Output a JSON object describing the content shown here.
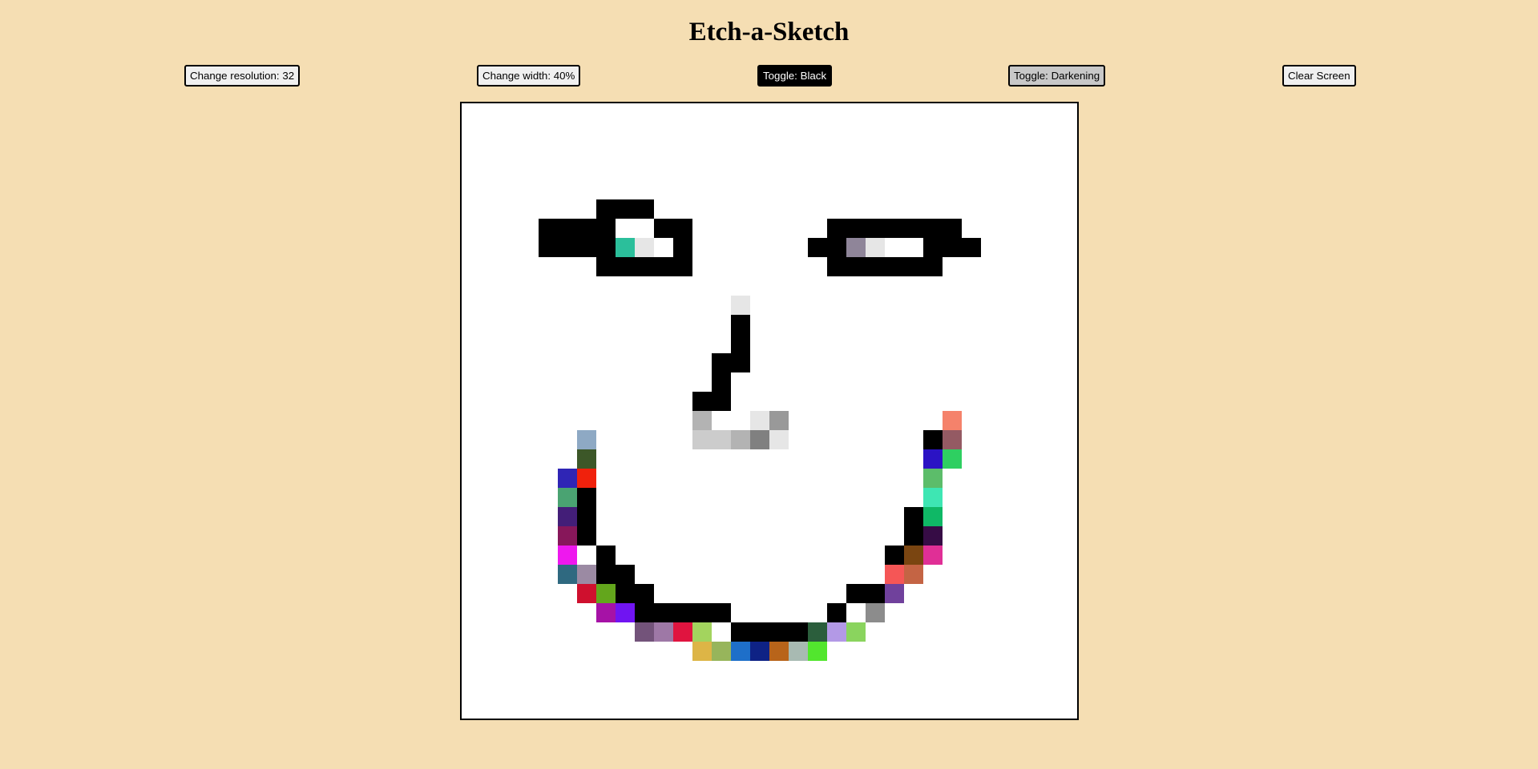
{
  "app": {
    "title": "Etch-a-Sketch"
  },
  "controls": {
    "resolution_label": "Change resolution: 32",
    "width_label": "Change width: 40%",
    "color_toggle_label": "Toggle: Black",
    "mode_toggle_label": "Toggle: Darkening",
    "clear_label": "Clear Screen"
  },
  "grid": {
    "resolution": 32,
    "background": "#ffffff",
    "painted_cells": [
      {
        "r": 5,
        "c": 7,
        "color": "#000000"
      },
      {
        "r": 5,
        "c": 8,
        "color": "#000000"
      },
      {
        "r": 5,
        "c": 9,
        "color": "#000000"
      },
      {
        "r": 6,
        "c": 4,
        "color": "#000000"
      },
      {
        "r": 6,
        "c": 5,
        "color": "#000000"
      },
      {
        "r": 6,
        "c": 6,
        "color": "#000000"
      },
      {
        "r": 6,
        "c": 7,
        "color": "#000000"
      },
      {
        "r": 6,
        "c": 10,
        "color": "#000000"
      },
      {
        "r": 6,
        "c": 11,
        "color": "#000000"
      },
      {
        "r": 6,
        "c": 19,
        "color": "#000000"
      },
      {
        "r": 6,
        "c": 20,
        "color": "#000000"
      },
      {
        "r": 6,
        "c": 21,
        "color": "#000000"
      },
      {
        "r": 6,
        "c": 22,
        "color": "#000000"
      },
      {
        "r": 6,
        "c": 23,
        "color": "#000000"
      },
      {
        "r": 6,
        "c": 24,
        "color": "#000000"
      },
      {
        "r": 6,
        "c": 25,
        "color": "#000000"
      },
      {
        "r": 7,
        "c": 4,
        "color": "#000000"
      },
      {
        "r": 7,
        "c": 5,
        "color": "#000000"
      },
      {
        "r": 7,
        "c": 6,
        "color": "#000000"
      },
      {
        "r": 7,
        "c": 7,
        "color": "#000000"
      },
      {
        "r": 7,
        "c": 8,
        "color": "#2bbf9b"
      },
      {
        "r": 7,
        "c": 9,
        "color": "#e6e6e6"
      },
      {
        "r": 7,
        "c": 11,
        "color": "#000000"
      },
      {
        "r": 7,
        "c": 18,
        "color": "#000000"
      },
      {
        "r": 7,
        "c": 19,
        "color": "#000000"
      },
      {
        "r": 7,
        "c": 20,
        "color": "#8f8599"
      },
      {
        "r": 7,
        "c": 21,
        "color": "#e6e6e6"
      },
      {
        "r": 7,
        "c": 24,
        "color": "#000000"
      },
      {
        "r": 7,
        "c": 25,
        "color": "#000000"
      },
      {
        "r": 7,
        "c": 26,
        "color": "#000000"
      },
      {
        "r": 8,
        "c": 7,
        "color": "#000000"
      },
      {
        "r": 8,
        "c": 8,
        "color": "#000000"
      },
      {
        "r": 8,
        "c": 9,
        "color": "#000000"
      },
      {
        "r": 8,
        "c": 10,
        "color": "#000000"
      },
      {
        "r": 8,
        "c": 11,
        "color": "#000000"
      },
      {
        "r": 8,
        "c": 19,
        "color": "#000000"
      },
      {
        "r": 8,
        "c": 20,
        "color": "#000000"
      },
      {
        "r": 8,
        "c": 21,
        "color": "#000000"
      },
      {
        "r": 8,
        "c": 22,
        "color": "#000000"
      },
      {
        "r": 8,
        "c": 23,
        "color": "#000000"
      },
      {
        "r": 8,
        "c": 24,
        "color": "#000000"
      },
      {
        "r": 10,
        "c": 14,
        "color": "#e6e6e6"
      },
      {
        "r": 11,
        "c": 14,
        "color": "#000000"
      },
      {
        "r": 12,
        "c": 14,
        "color": "#000000"
      },
      {
        "r": 13,
        "c": 13,
        "color": "#000000"
      },
      {
        "r": 13,
        "c": 14,
        "color": "#000000"
      },
      {
        "r": 14,
        "c": 13,
        "color": "#000000"
      },
      {
        "r": 15,
        "c": 12,
        "color": "#000000"
      },
      {
        "r": 15,
        "c": 13,
        "color": "#000000"
      },
      {
        "r": 16,
        "c": 12,
        "color": "#b3b3b3"
      },
      {
        "r": 16,
        "c": 15,
        "color": "#e6e6e6"
      },
      {
        "r": 16,
        "c": 16,
        "color": "#999999"
      },
      {
        "r": 16,
        "c": 25,
        "color": "#f5826b"
      },
      {
        "r": 17,
        "c": 6,
        "color": "#8ea9c4"
      },
      {
        "r": 17,
        "c": 12,
        "color": "#cccccc"
      },
      {
        "r": 17,
        "c": 13,
        "color": "#cccccc"
      },
      {
        "r": 17,
        "c": 14,
        "color": "#b3b3b3"
      },
      {
        "r": 17,
        "c": 15,
        "color": "#808080"
      },
      {
        "r": 17,
        "c": 16,
        "color": "#e6e6e6"
      },
      {
        "r": 17,
        "c": 24,
        "color": "#000000"
      },
      {
        "r": 17,
        "c": 25,
        "color": "#945a63"
      },
      {
        "r": 18,
        "c": 6,
        "color": "#3c5728"
      },
      {
        "r": 18,
        "c": 24,
        "color": "#2b13c4"
      },
      {
        "r": 18,
        "c": 25,
        "color": "#2ecf61"
      },
      {
        "r": 19,
        "c": 5,
        "color": "#2f25b5"
      },
      {
        "r": 19,
        "c": 6,
        "color": "#f0210c"
      },
      {
        "r": 19,
        "c": 24,
        "color": "#5cbd6a"
      },
      {
        "r": 20,
        "c": 5,
        "color": "#4aa372"
      },
      {
        "r": 20,
        "c": 6,
        "color": "#000000"
      },
      {
        "r": 20,
        "c": 24,
        "color": "#3ee6b3"
      },
      {
        "r": 21,
        "c": 5,
        "color": "#431e78"
      },
      {
        "r": 21,
        "c": 6,
        "color": "#000000"
      },
      {
        "r": 21,
        "c": 23,
        "color": "#000000"
      },
      {
        "r": 21,
        "c": 24,
        "color": "#0fb866"
      },
      {
        "r": 22,
        "c": 5,
        "color": "#87175a"
      },
      {
        "r": 22,
        "c": 6,
        "color": "#000000"
      },
      {
        "r": 22,
        "c": 23,
        "color": "#000000"
      },
      {
        "r": 22,
        "c": 24,
        "color": "#360c45"
      },
      {
        "r": 23,
        "c": 5,
        "color": "#ee18ee"
      },
      {
        "r": 23,
        "c": 7,
        "color": "#000000"
      },
      {
        "r": 23,
        "c": 22,
        "color": "#000000"
      },
      {
        "r": 23,
        "c": 23,
        "color": "#7a4511"
      },
      {
        "r": 23,
        "c": 24,
        "color": "#e02f96"
      },
      {
        "r": 24,
        "c": 5,
        "color": "#2f6980"
      },
      {
        "r": 24,
        "c": 6,
        "color": "#9b8aa3"
      },
      {
        "r": 24,
        "c": 7,
        "color": "#000000"
      },
      {
        "r": 24,
        "c": 8,
        "color": "#000000"
      },
      {
        "r": 24,
        "c": 22,
        "color": "#f55656"
      },
      {
        "r": 24,
        "c": 23,
        "color": "#c46444"
      },
      {
        "r": 25,
        "c": 6,
        "color": "#cf102e"
      },
      {
        "r": 25,
        "c": 7,
        "color": "#63a61c"
      },
      {
        "r": 25,
        "c": 8,
        "color": "#000000"
      },
      {
        "r": 25,
        "c": 9,
        "color": "#000000"
      },
      {
        "r": 25,
        "c": 20,
        "color": "#000000"
      },
      {
        "r": 25,
        "c": 21,
        "color": "#000000"
      },
      {
        "r": 25,
        "c": 22,
        "color": "#70419c"
      },
      {
        "r": 26,
        "c": 7,
        "color": "#a612a6"
      },
      {
        "r": 26,
        "c": 8,
        "color": "#7014f2"
      },
      {
        "r": 26,
        "c": 9,
        "color": "#000000"
      },
      {
        "r": 26,
        "c": 10,
        "color": "#000000"
      },
      {
        "r": 26,
        "c": 11,
        "color": "#000000"
      },
      {
        "r": 26,
        "c": 12,
        "color": "#000000"
      },
      {
        "r": 26,
        "c": 13,
        "color": "#000000"
      },
      {
        "r": 26,
        "c": 19,
        "color": "#000000"
      },
      {
        "r": 26,
        "c": 21,
        "color": "#8c8c8c"
      },
      {
        "r": 27,
        "c": 9,
        "color": "#73537a"
      },
      {
        "r": 27,
        "c": 10,
        "color": "#9e78a6"
      },
      {
        "r": 27,
        "c": 11,
        "color": "#e0143f"
      },
      {
        "r": 27,
        "c": 12,
        "color": "#a3d45e"
      },
      {
        "r": 27,
        "c": 14,
        "color": "#000000"
      },
      {
        "r": 27,
        "c": 15,
        "color": "#000000"
      },
      {
        "r": 27,
        "c": 16,
        "color": "#000000"
      },
      {
        "r": 27,
        "c": 17,
        "color": "#000000"
      },
      {
        "r": 27,
        "c": 18,
        "color": "#2b5e3c"
      },
      {
        "r": 27,
        "c": 19,
        "color": "#b399e6"
      },
      {
        "r": 27,
        "c": 20,
        "color": "#8ad45e"
      },
      {
        "r": 28,
        "c": 12,
        "color": "#ddb546"
      },
      {
        "r": 28,
        "c": 13,
        "color": "#97b55b"
      },
      {
        "r": 28,
        "c": 14,
        "color": "#1e6fc9"
      },
      {
        "r": 28,
        "c": 15,
        "color": "#0e2285"
      },
      {
        "r": 28,
        "c": 16,
        "color": "#b8641a"
      },
      {
        "r": 28,
        "c": 17,
        "color": "#a8bab2"
      },
      {
        "r": 28,
        "c": 18,
        "color": "#52e62e"
      }
    ]
  }
}
